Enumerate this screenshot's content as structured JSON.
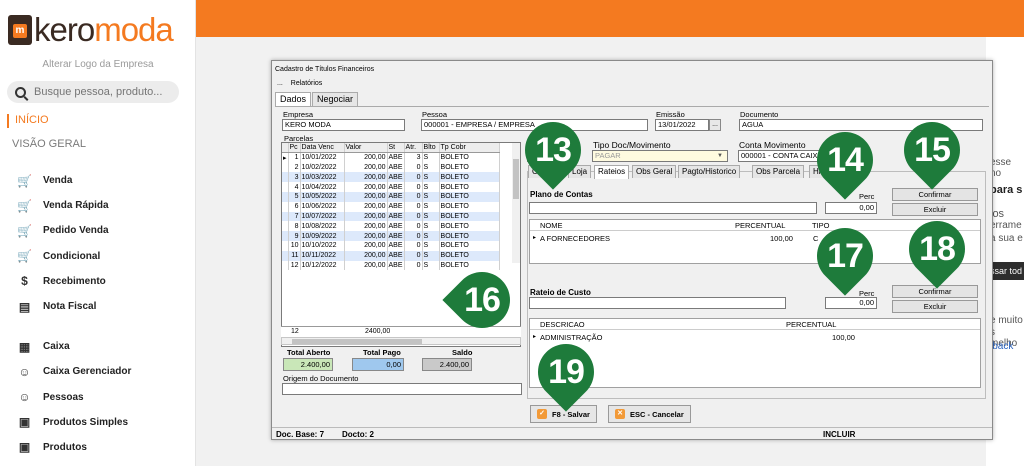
{
  "brand": {
    "logo_kero": "kero",
    "logo_moda": "moda",
    "logo_bag_letter": "m",
    "alter_logo": "Alterar Logo da Empresa",
    "accent": "#f47a20",
    "dark": "#3a2a22"
  },
  "search": {
    "placeholder": "Busque pessoa, produto..."
  },
  "menu": {
    "inicio": "INÍCIO",
    "visao_geral": "VISÃO GERAL"
  },
  "nav": [
    {
      "label": "Venda",
      "icon": "cart-icon"
    },
    {
      "label": "Venda Rápida",
      "icon": "cart-icon"
    },
    {
      "label": "Pedido Venda",
      "icon": "cart-icon"
    },
    {
      "label": "Condicional",
      "icon": "cart-icon"
    },
    {
      "label": "Recebimento",
      "icon": "money-hand-icon"
    },
    {
      "label": "Nota Fiscal",
      "icon": "nfe-icon"
    },
    {
      "label": "Caixa",
      "icon": "cash-register-icon"
    },
    {
      "label": "Caixa Gerenciador",
      "icon": "user-lock-icon"
    },
    {
      "label": "Pessoas",
      "icon": "people-icon"
    },
    {
      "label": "Produtos Simples",
      "icon": "box-icon"
    },
    {
      "label": "Produtos",
      "icon": "box-icon"
    }
  ],
  "bg": {
    "t1": "esse no",
    "t2": "para s",
    "t3": "los",
    "t4": "errame",
    "t5": "a sua e",
    "t6": "ssar tod",
    "t7": "e muito",
    "t8": "s melho",
    "t9": "lback"
  },
  "window": {
    "title": "Cadastro de Títulos Financeiros",
    "menu": [
      "...",
      "Relatórios"
    ],
    "tabs": [
      "Dados",
      "Negociar"
    ],
    "empresa_label": "Empresa",
    "empresa_value": "KERO MODA",
    "pessoa_label": "Pessoa",
    "pessoa_value": "000001 - EMPRESA / EMPRESA",
    "emissao_label": "Emissão",
    "emissao_value": "13/01/2022",
    "emissao_btn": "...",
    "documento_label": "Documento",
    "documento_value": "AGUA",
    "parcelas_label": "Parcelas",
    "tipo_doc_label": "Tipo Doc/Movimento",
    "tipo_doc_value": "PAGAR",
    "conta_mov_label": "Conta Movimento",
    "conta_mov_value": "000001 - CONTA CAIXA",
    "p_label": "P",
    "p_value": "1",
    "grid_headers": [
      "Pc",
      "Data Venc",
      "Valor",
      "St",
      "Atr.",
      "Blto",
      "Tp Cobr"
    ],
    "grid_rows": [
      [
        "1",
        "10/01/2022",
        "200,00",
        "ABE",
        "3",
        "S",
        "BOLETO"
      ],
      [
        "2",
        "10/02/2022",
        "200,00",
        "ABE",
        "0",
        "S",
        "BOLETO"
      ],
      [
        "3",
        "10/03/2022",
        "200,00",
        "ABE",
        "0",
        "S",
        "BOLETO"
      ],
      [
        "4",
        "10/04/2022",
        "200,00",
        "ABE",
        "0",
        "S",
        "BOLETO"
      ],
      [
        "5",
        "10/05/2022",
        "200,00",
        "ABE",
        "0",
        "S",
        "BOLETO"
      ],
      [
        "6",
        "10/06/2022",
        "200,00",
        "ABE",
        "0",
        "S",
        "BOLETO"
      ],
      [
        "7",
        "10/07/2022",
        "200,00",
        "ABE",
        "0",
        "S",
        "BOLETO"
      ],
      [
        "8",
        "10/08/2022",
        "200,00",
        "ABE",
        "0",
        "S",
        "BOLETO"
      ],
      [
        "9",
        "10/09/2022",
        "200,00",
        "ABE",
        "0",
        "S",
        "BOLETO"
      ],
      [
        "10",
        "10/10/2022",
        "200,00",
        "ABE",
        "0",
        "S",
        "BOLETO"
      ],
      [
        "11",
        "10/11/2022",
        "200,00",
        "ABE",
        "0",
        "S",
        "BOLETO"
      ],
      [
        "12",
        "10/12/2022",
        "200,00",
        "ABE",
        "0",
        "S",
        "BOLETO"
      ]
    ],
    "grid_foot_count": "12",
    "grid_foot_total": "2400,00",
    "total_aberto_label": "Total Aberto",
    "total_aberto_value": "2.400,00",
    "total_pago_label": "Total Pago",
    "total_pago_value": "0,00",
    "saldo_label": "Saldo",
    "saldo_value": "2.400,00",
    "origem_label": "Origem do Documento",
    "subtabs": [
      "Cre",
      "Loja",
      "Rateios",
      "Obs Geral",
      "Pagto/Historico",
      "Obs Parcela",
      "His"
    ],
    "plano_label": "Plano de Contas",
    "perc_label": "Perc",
    "perc_value": "0,00",
    "plano_grid_headers": [
      "NOME",
      "PERCENTUAL",
      "TIPO"
    ],
    "plano_grid_row": [
      "A FORNECEDORES",
      "100,00",
      "C"
    ],
    "rateio_label": "Rateio de Custo",
    "perc2_label": "Perc",
    "perc2_value": "0,00",
    "rateio_grid_headers": [
      "DESCRICAO",
      "PERCENTUAL"
    ],
    "rateio_grid_row": [
      "ADMINISTRAÇÃO",
      "100,00"
    ],
    "confirmar_label": "Confirmar",
    "excluir_label": "Excluir",
    "confirmar2_label": "Confirmar",
    "excluir2_label": "Excluir",
    "salvar_label": "F8 - Salvar",
    "cancelar_label": "ESC - Cancelar",
    "status_base": "Doc. Base: 7",
    "status_docto": "Docto: 2",
    "status_mode": "INCLUIR"
  },
  "badges": {
    "b13": "13",
    "b14": "14",
    "b15": "15",
    "b16": "16",
    "b17": "17",
    "b18": "18",
    "b19": "19",
    "color": "#1e7b3b"
  }
}
